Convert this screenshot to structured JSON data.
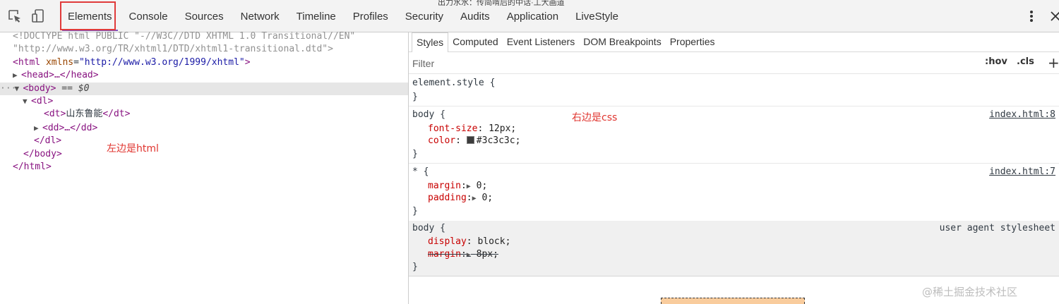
{
  "tabs": [
    "Elements",
    "Console",
    "Sources",
    "Network",
    "Timeline",
    "Profiles",
    "Security",
    "Audits",
    "Application",
    "LiveStyle"
  ],
  "top_strip_text": "出力水水：传简啃后的中话·工大画道",
  "dom": {
    "doctype_1": "<!DOCTYPE html PUBLIC \"-//W3C//DTD XHTML 1.0 Transitional//EN\"",
    "doctype_2": "\"http://www.w3.org/TR/xhtml1/DTD/xhtml1-transitional.dtd\">",
    "html_open": "<html",
    "html_attr_name": "xmlns",
    "html_attr_value": "\"http://www.w3.org/1999/xhtml\"",
    "html_close_bracket": ">",
    "head": "<head>…</head>",
    "body_open": "<body>",
    "body_eq": " == ",
    "body_var": "$0",
    "dl_open": "<dl>",
    "dt_open": "<dt>",
    "dt_text": "山东鲁能",
    "dt_close": "</dt>",
    "dd": "<dd>…</dd>",
    "dl_close": "</dl>",
    "body_close": "</body>",
    "html_close": "</html>"
  },
  "annotations": {
    "left": "左边是html",
    "right": "右边是css"
  },
  "styles": {
    "subtabs": [
      "Styles",
      "Computed",
      "Event Listeners",
      "DOM Breakpoints",
      "Properties"
    ],
    "filter_placeholder": "Filter",
    "hov": ":hov",
    "cls": ".cls",
    "plus": "+",
    "element_style": "element.style {",
    "close_brace": "}",
    "rule1": {
      "selector": "body {",
      "source": "index.html:8",
      "p1_name": "font-size",
      "p1_value": "12px;",
      "p2_name": "color",
      "p2_value": "#3c3c3c;"
    },
    "rule2": {
      "selector": "* {",
      "source": "index.html:7",
      "p1_name": "margin",
      "p1_value": "0;",
      "p2_name": "padding",
      "p2_value": "0;"
    },
    "rule3": {
      "selector": "body {",
      "source": "user agent stylesheet",
      "p1_name": "display",
      "p1_value": "block;",
      "p2_name": "margin",
      "p2_value": "8px;"
    }
  },
  "colors": {
    "accent_underline": "#7e57c2",
    "highlight_box": "#e03a3a",
    "swatch": "#3c3c3c"
  },
  "icons": [
    "inspect-icon",
    "device-toolbar-icon",
    "more-options-icon",
    "close-icon"
  ],
  "watermark": "@稀土掘金技术社区"
}
